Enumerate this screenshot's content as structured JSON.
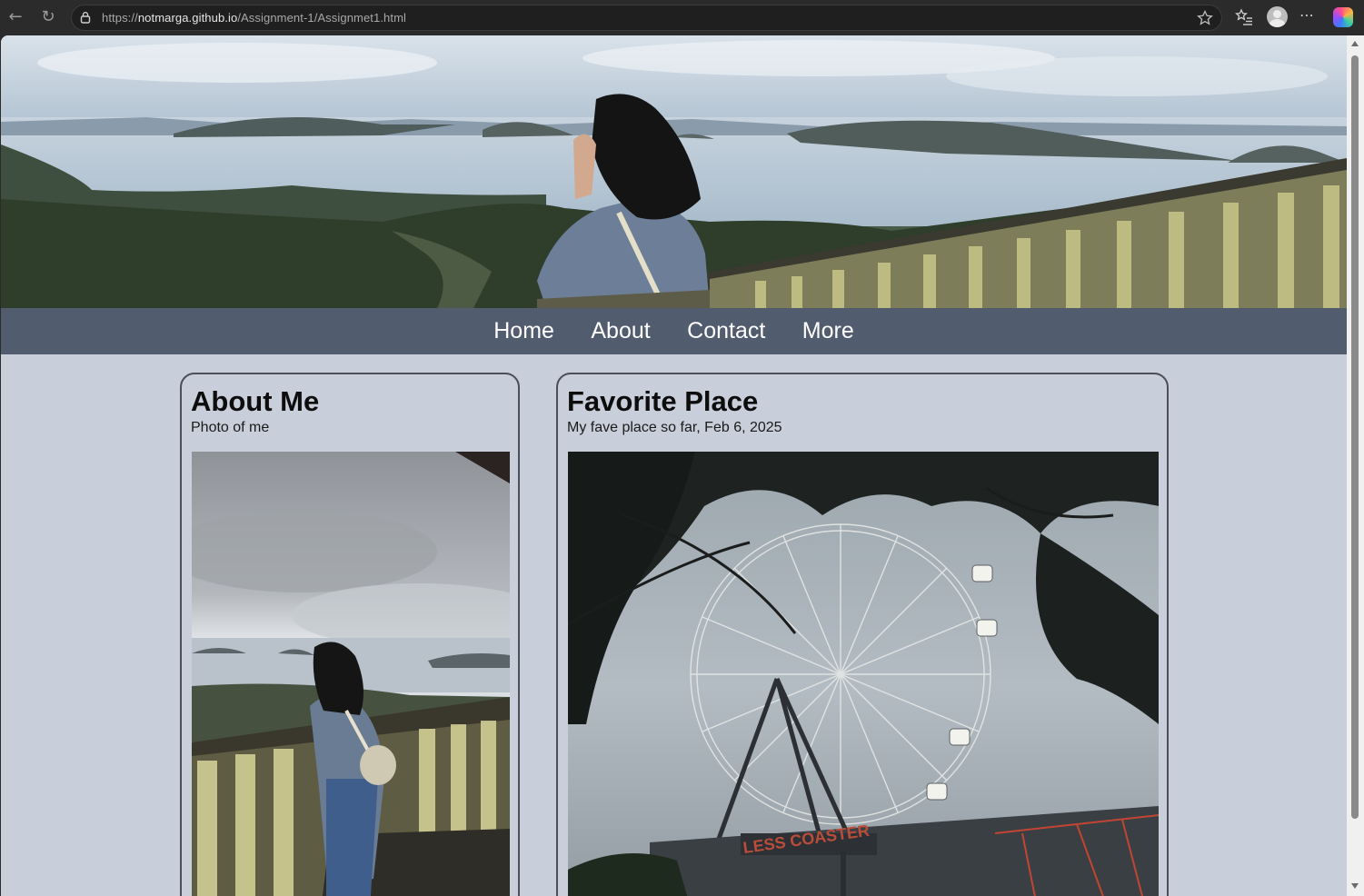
{
  "browser": {
    "url_prefix": "https://",
    "url_host": "notmarga.github.io",
    "url_path": "/Assignment-1/Assignmet1.html"
  },
  "nav": {
    "items": [
      {
        "label": "Home"
      },
      {
        "label": "About"
      },
      {
        "label": "Contact"
      },
      {
        "label": "More"
      }
    ]
  },
  "about_card": {
    "title": "About Me",
    "subtitle": "Photo of me"
  },
  "favorite_card": {
    "title": "Favorite Place",
    "subtitle": "My fave place so far, Feb 6, 2025"
  },
  "colors": {
    "page_background": "#c8ceda",
    "navbar_background": "#525c6f",
    "card_border": "#4a4f58",
    "chrome_background": "#2b2b2b"
  }
}
